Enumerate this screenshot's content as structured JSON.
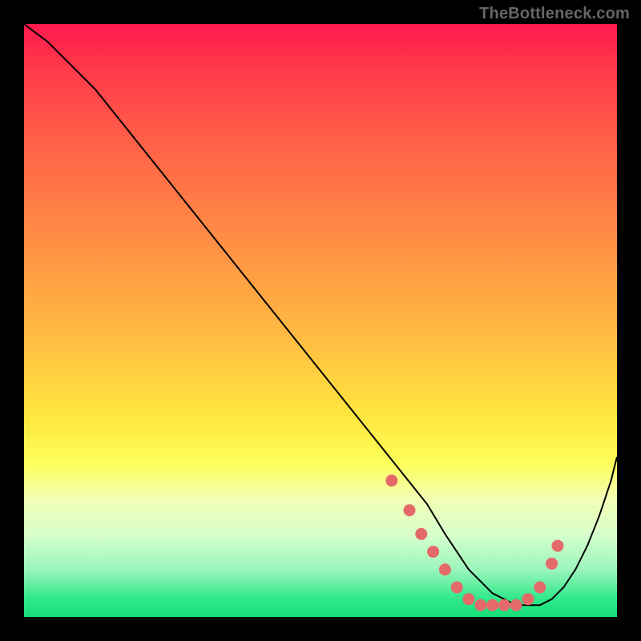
{
  "watermark": "TheBottleneck.com",
  "chart_data": {
    "type": "line",
    "title": "",
    "xlabel": "",
    "ylabel": "",
    "xlim": [
      0,
      100
    ],
    "ylim": [
      0,
      100
    ],
    "series": [
      {
        "name": "curve",
        "x": [
          0,
          4,
          8,
          12,
          16,
          20,
          24,
          28,
          32,
          36,
          40,
          44,
          48,
          52,
          56,
          60,
          64,
          68,
          71,
          73,
          75,
          77,
          79,
          81,
          83,
          85,
          87,
          89,
          91,
          93,
          95,
          97,
          99,
          100
        ],
        "y": [
          100,
          97,
          93,
          89,
          84,
          79,
          74,
          69,
          64,
          59,
          54,
          49,
          44,
          39,
          34,
          29,
          24,
          19,
          14,
          11,
          8,
          6,
          4,
          3,
          2,
          2,
          2,
          3,
          5,
          8,
          12,
          17,
          23,
          27
        ]
      }
    ],
    "markers": {
      "x": [
        62,
        65,
        67,
        69,
        71,
        73,
        75,
        77,
        79,
        81,
        83,
        85,
        87,
        89,
        90
      ],
      "y": [
        23,
        18,
        14,
        11,
        8,
        5,
        3,
        2,
        2,
        2,
        2,
        3,
        5,
        9,
        12
      ]
    },
    "gradient_stops": [
      {
        "pos": 0.0,
        "color": "#ff1a4d"
      },
      {
        "pos": 0.22,
        "color": "#ff6647"
      },
      {
        "pos": 0.54,
        "color": "#ffbf41"
      },
      {
        "pos": 0.74,
        "color": "#fdff5a"
      },
      {
        "pos": 0.92,
        "color": "#9cf5bc"
      },
      {
        "pos": 1.0,
        "color": "#17e07a"
      }
    ]
  }
}
